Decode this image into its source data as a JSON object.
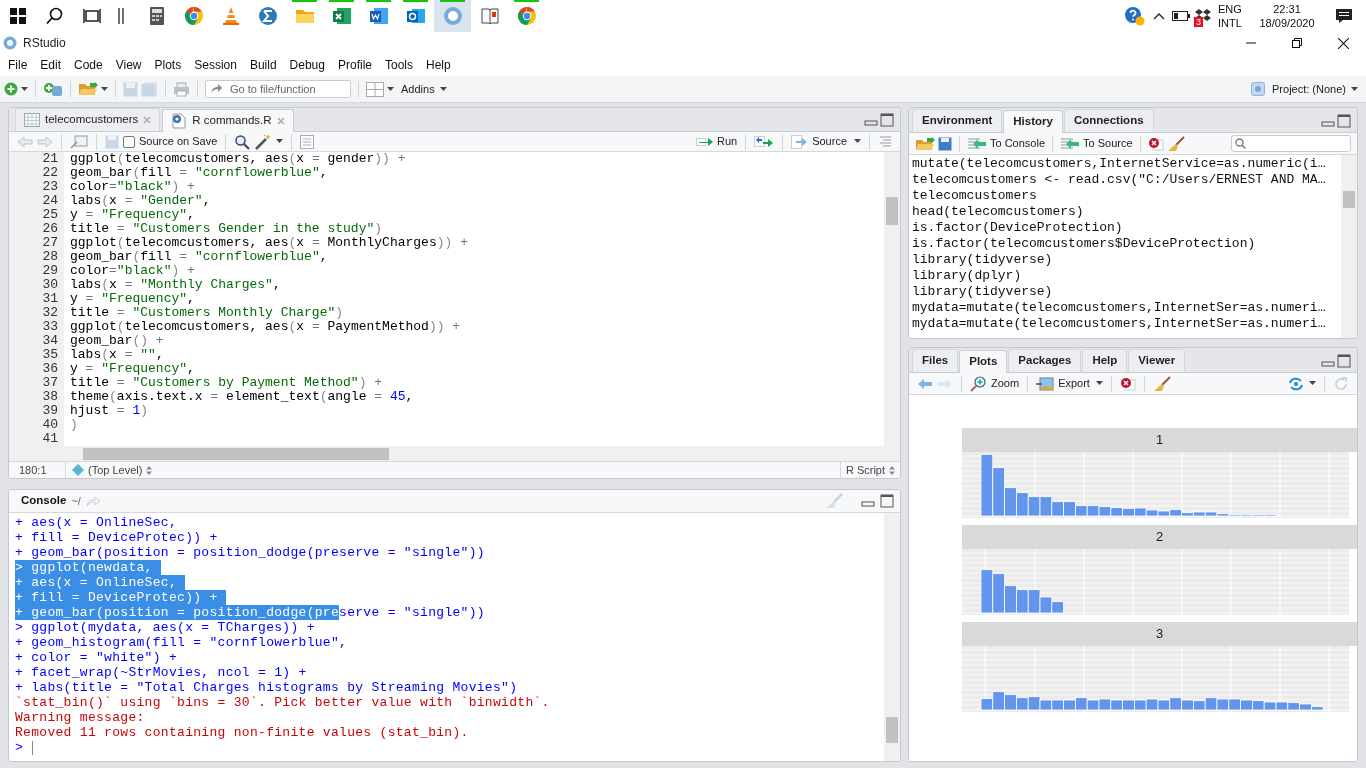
{
  "taskbar": {
    "apps": [
      {
        "kind": "calculator",
        "running": false,
        "selected": false
      },
      {
        "kind": "browser",
        "running": false,
        "selected": false
      },
      {
        "kind": "cone",
        "running": false,
        "selected": false
      },
      {
        "kind": "sigma",
        "running": false,
        "selected": false
      },
      {
        "kind": "folder",
        "running": true,
        "selected": false
      },
      {
        "kind": "spreadsheet",
        "running": true,
        "selected": false
      },
      {
        "kind": "document",
        "running": true,
        "selected": false
      },
      {
        "kind": "mail",
        "running": true,
        "selected": false
      },
      {
        "kind": "r",
        "running": true,
        "selected": true
      },
      {
        "kind": "reader",
        "running": false,
        "selected": false
      },
      {
        "kind": "browser",
        "running": true,
        "selected": false
      }
    ],
    "tray": {
      "badge": "3",
      "language": "ENG",
      "layout": "INTL",
      "time": "22:31",
      "date": "18/09/2020"
    }
  },
  "window": {
    "title": "RStudio"
  },
  "menu": [
    "File",
    "Edit",
    "Code",
    "View",
    "Plots",
    "Session",
    "Build",
    "Debug",
    "Profile",
    "Tools",
    "Help"
  ],
  "toolbar": {
    "goto_placeholder": "Go to file/function",
    "addins": "Addins",
    "project": "Project: (None)"
  },
  "editor": {
    "tabs": [
      {
        "label": "telecomcustomers",
        "kind": "data",
        "selected": false
      },
      {
        "label": "R commands.R",
        "kind": "script",
        "selected": true
      }
    ],
    "source_on_save": {
      "label": "Source on Save",
      "checked": false
    },
    "run": "Run",
    "source": "Source",
    "lines": [
      {
        "number": "21",
        "code": "ggplot(telecomcustomers, aes(x = gender)) +"
      },
      {
        "number": "22",
        "code": "geom_bar(fill = \"cornflowerblue\","
      },
      {
        "number": "23",
        "code": "color=\"black\") +"
      },
      {
        "number": "24",
        "code": "labs(x = \"Gender\","
      },
      {
        "number": "25",
        "code": "y = \"Frequency\","
      },
      {
        "number": "26",
        "code": "title = \"Customers Gender in the study\")"
      },
      {
        "number": "27",
        "code": "ggplot(telecomcustomers, aes(x = MonthlyCharges)) +"
      },
      {
        "number": "28",
        "code": "geom_bar(fill = \"cornflowerblue\","
      },
      {
        "number": "29",
        "code": "color=\"black\") +"
      },
      {
        "number": "30",
        "code": "labs(x = \"Monthly Charges\","
      },
      {
        "number": "31",
        "code": "y = \"Frequency\","
      },
      {
        "number": "32",
        "code": "title = \"Customers Monthly Charge\")"
      },
      {
        "number": "33",
        "code": "ggplot(telecomcustomers, aes(x = PaymentMethod)) +"
      },
      {
        "number": "34",
        "code": "geom_bar() +"
      },
      {
        "number": "35",
        "code": "labs(x = \"\","
      },
      {
        "number": "36",
        "code": "y = \"Frequency\","
      },
      {
        "number": "37",
        "code": "title = \"Customers by Payment Method\") +"
      },
      {
        "number": "38",
        "code": "theme(axis.text.x = element_text(angle = 45,"
      },
      {
        "number": "39",
        "code": "hjust = 1)"
      },
      {
        "number": "40",
        "code": ")"
      },
      {
        "number": "41"
      }
    ],
    "position": "180:1",
    "scope": "(Top Level)",
    "file_type": "R Script"
  },
  "console": {
    "title": "Console",
    "path": "~/",
    "lines": [
      {
        "kind": "input",
        "prompt": "+",
        "text": "aes(x = OnlineSec,",
        "selected": false
      },
      {
        "kind": "input",
        "prompt": "+",
        "text": "fill = DeviceProtec)) +",
        "selected": false
      },
      {
        "kind": "input",
        "prompt": "+",
        "text": "geom_bar(position = position_dodge(preserve = \"single\"))",
        "selected": false
      },
      {
        "kind": "input",
        "prompt": ">",
        "text": "ggplot(newdata, ",
        "selected": true
      },
      {
        "kind": "input",
        "prompt": "+",
        "text": "aes(x = OnlineSec, ",
        "selected": true
      },
      {
        "kind": "input",
        "prompt": "+",
        "text": "fill = DeviceProtec)) + ",
        "selected": true
      },
      {
        "kind": "input",
        "prompt": "+",
        "text": "geom_bar(position = position_dodge(pre",
        "rest": "serve = \"single\"))",
        "selected": true
      },
      {
        "kind": "input",
        "prompt": ">",
        "text": "ggplot(mydata, aes(x = TCharges)) +",
        "selected": false
      },
      {
        "kind": "input",
        "prompt": "+",
        "text": "geom_histogram(fill = \"cornflowerblue\",",
        "selected": false
      },
      {
        "kind": "input",
        "prompt": "+",
        "text": "color = \"white\") +",
        "selected": false
      },
      {
        "kind": "input",
        "prompt": "+",
        "text": "facet_wrap(~StrMovies, ncol = 1) +",
        "selected": false
      },
      {
        "kind": "input",
        "prompt": "+",
        "text": "labs(title = \"Total Charges histograms by Streaming Movies\")",
        "selected": false
      },
      {
        "kind": "error",
        "text": "`stat_bin()` using `bins = 30`. Pick better value with `binwidth`."
      },
      {
        "kind": "error",
        "text": "Warning message:"
      },
      {
        "kind": "error",
        "text": "Removed 11 rows containing non-finite values (stat_bin)."
      },
      {
        "kind": "prompt",
        "prompt": ">"
      }
    ]
  },
  "history_pane": {
    "tabs": [
      {
        "label": "Environment",
        "selected": false
      },
      {
        "label": "History",
        "selected": true
      },
      {
        "label": "Connections",
        "selected": false
      }
    ],
    "to_console": "To Console",
    "to_source": "To Source",
    "history": [
      "mutate(telecomcustomers,InternetService=as.numeric(i…",
      "telecomcustomers <- read.csv(\"C:/Users/ERNEST AND MA…",
      "telecomcustomers",
      "head(telecomcustomers)",
      "is.factor(DeviceProtection)",
      "is.factor(telecomcustomers$DeviceProtection)",
      "library(tidyverse)",
      "library(dplyr)",
      "library(tidyverse)",
      "mydata=mutate(telecomcustomers,InternetSer=as.numeri…",
      "mydata=mutate(telecomcustomers,InternetSer=as.numeri…"
    ]
  },
  "plots_pane": {
    "tabs": [
      {
        "label": "Files",
        "selected": false
      },
      {
        "label": "Plots",
        "selected": true
      },
      {
        "label": "Packages",
        "selected": false
      },
      {
        "label": "Help",
        "selected": false
      },
      {
        "label": "Viewer",
        "selected": false
      }
    ],
    "zoom": "Zoom",
    "export": "Export",
    "facets": [
      {
        "label": "1"
      },
      {
        "label": "2"
      },
      {
        "label": "3"
      }
    ]
  }
}
